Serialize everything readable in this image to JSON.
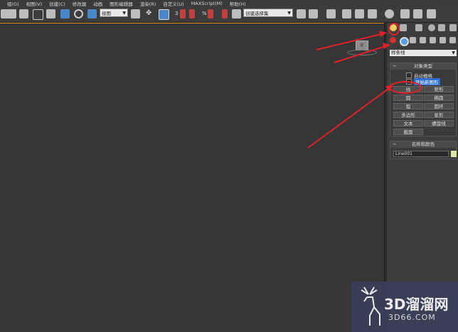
{
  "menu": [
    "组(G)",
    "视图(V)",
    "创建(C)",
    "修改器",
    "动画",
    "图形编辑器",
    "渲染(R)",
    "自定义(U)",
    "MAXScript(M)",
    "帮助(H)"
  ],
  "toolbar": {
    "view_select": "视图",
    "snap_num": "3",
    "selection_set_placeholder": "创建选择集"
  },
  "viewport": {
    "cube_label": "前"
  },
  "panel": {
    "dropdown": "样条线",
    "object_type": {
      "title": "对象类型",
      "auto_grid": "自动栅格",
      "start_new_shape": "开始新图形",
      "buttons": [
        "线",
        "矩形",
        "圆",
        "椭圆",
        "弧",
        "圆环",
        "多边形",
        "星形",
        "文本",
        "螺旋线",
        "截面"
      ]
    },
    "name_color": {
      "title": "名称和颜色",
      "name": "Line001",
      "swatch_color": "#dfe8a0"
    }
  },
  "annotation_color": "#e0202a",
  "watermark": {
    "brand": "3D溜溜网",
    "site": "3D66.COM"
  }
}
